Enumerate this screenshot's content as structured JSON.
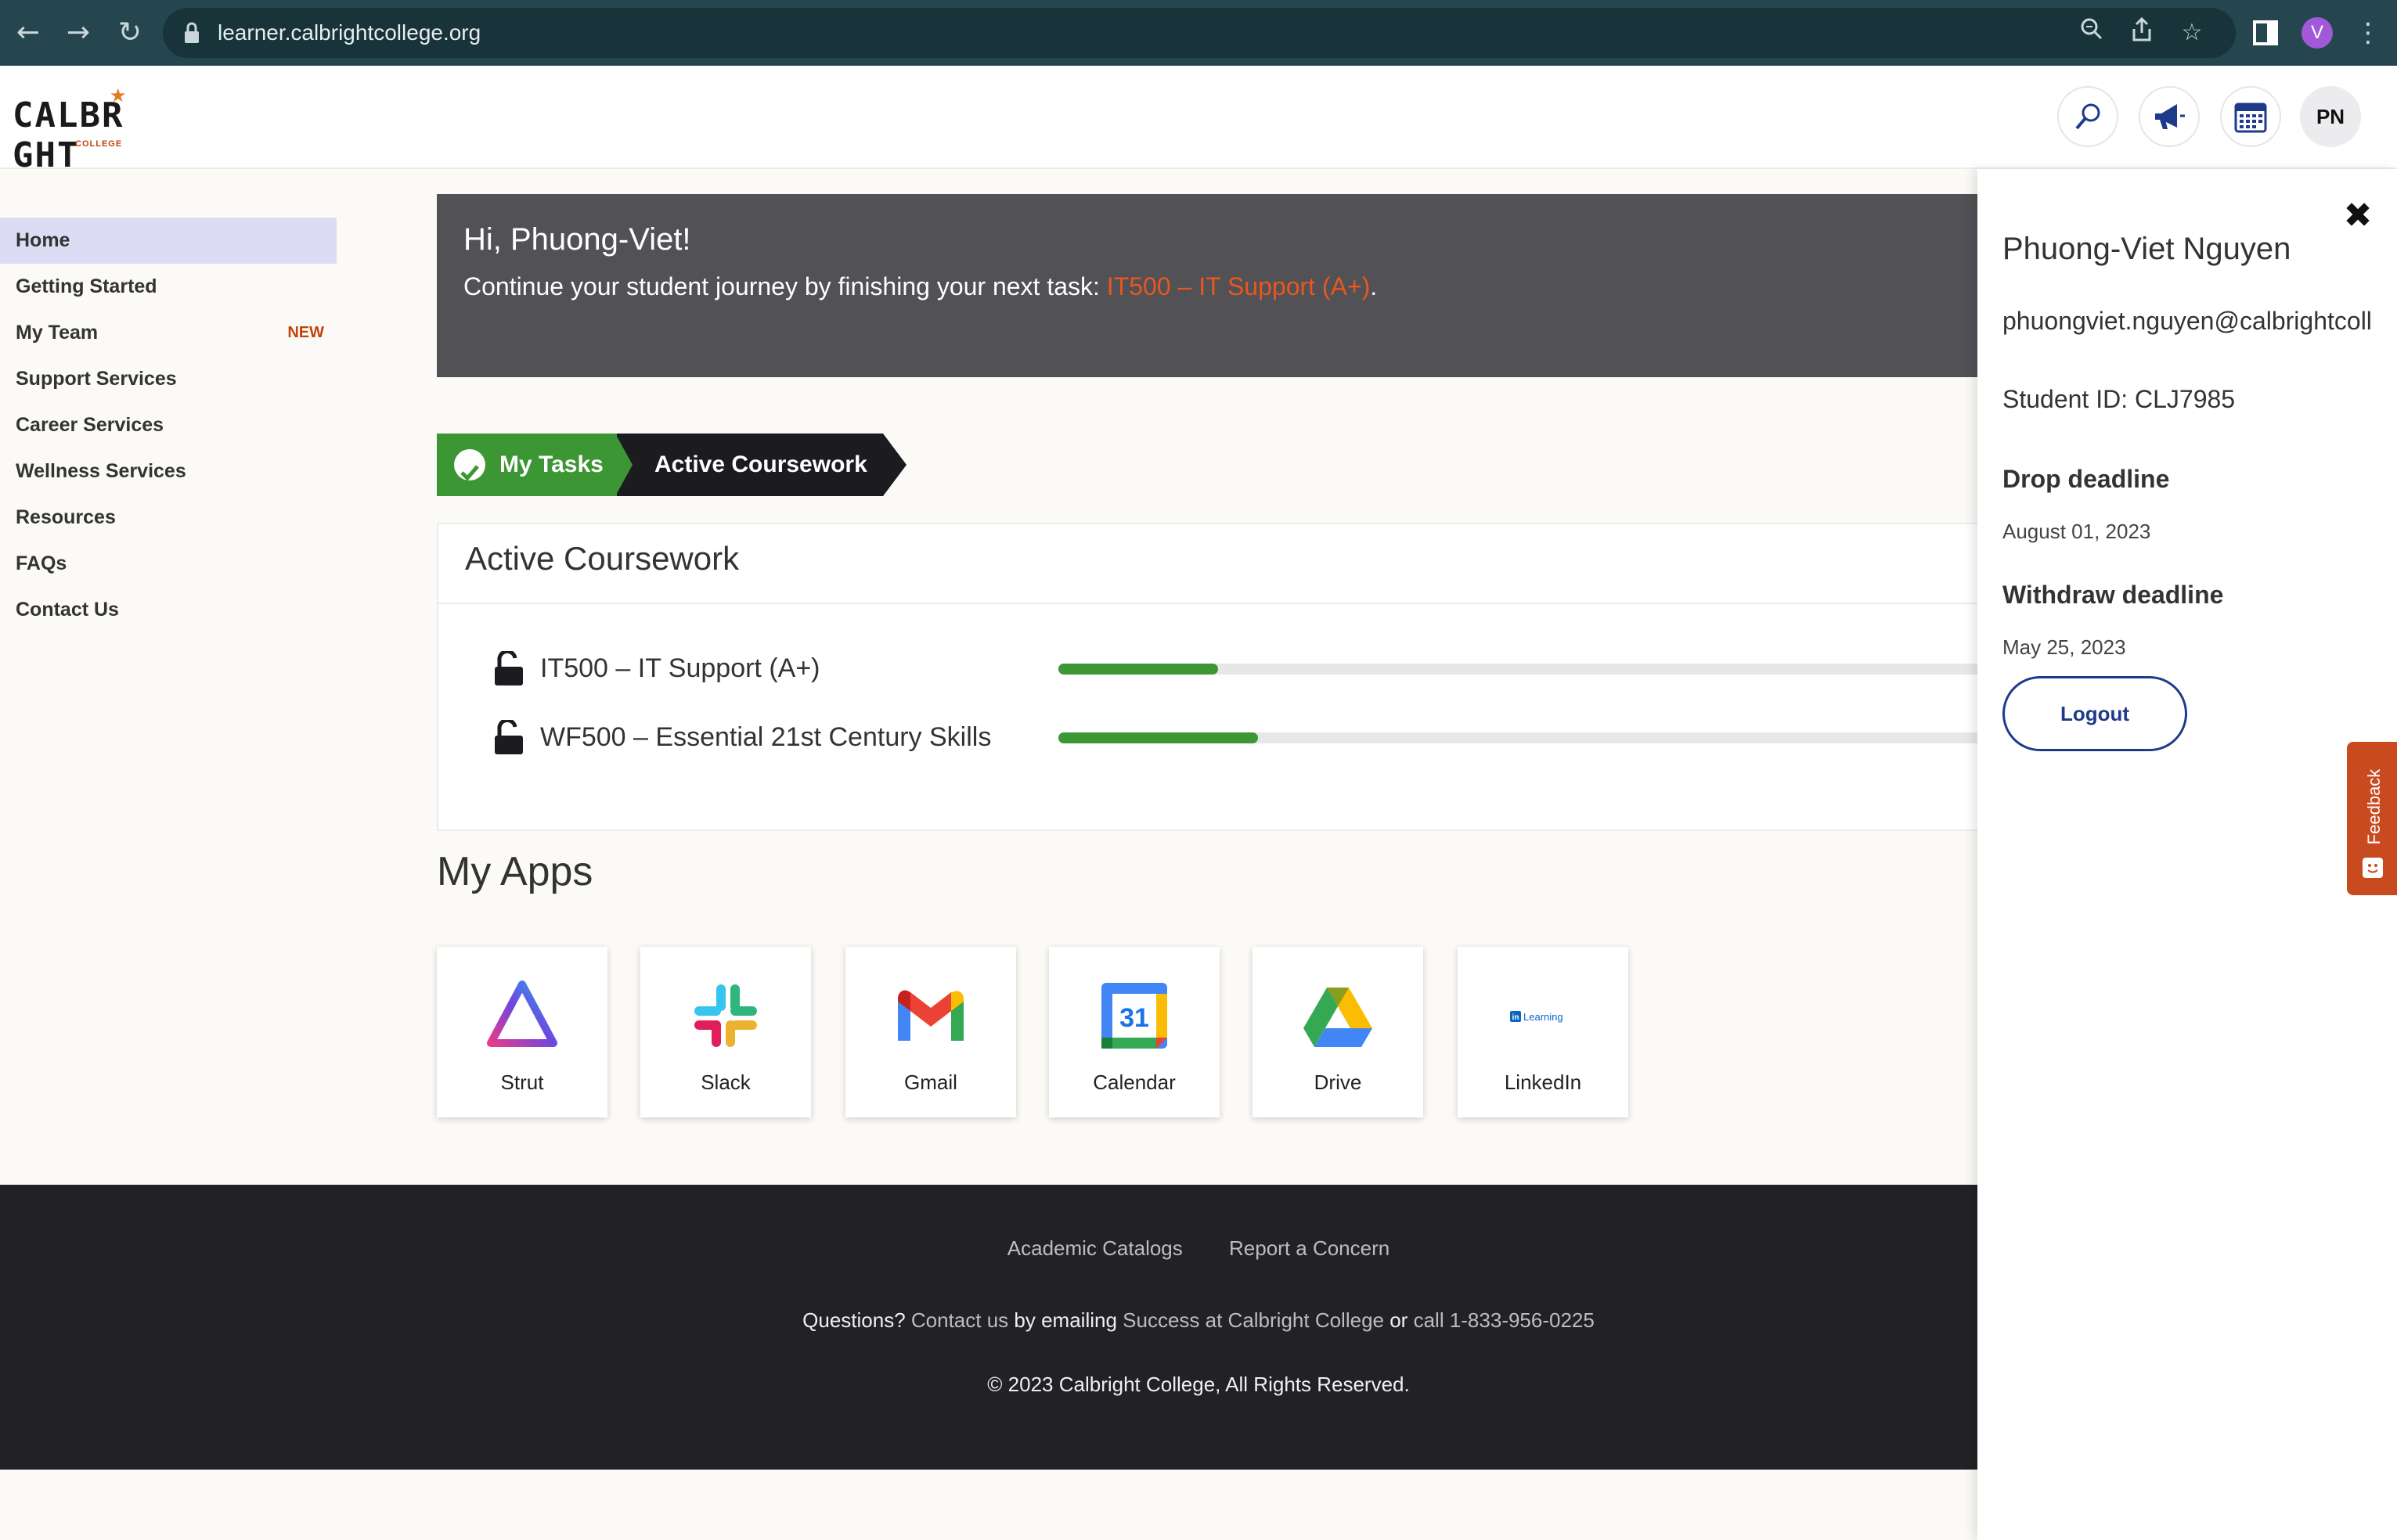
{
  "browser": {
    "url": "learner.calbrightcollege.org",
    "profile_initial": "V"
  },
  "header": {
    "logo_text": "CALBR GHT",
    "logo_sub": "COLLEGE",
    "avatar_initials": "PN"
  },
  "sidebar": {
    "items": [
      {
        "label": "Home",
        "badge": ""
      },
      {
        "label": "Getting Started",
        "badge": ""
      },
      {
        "label": "My Team",
        "badge": "NEW"
      },
      {
        "label": "Support Services",
        "badge": ""
      },
      {
        "label": "Career Services",
        "badge": ""
      },
      {
        "label": "Wellness Services",
        "badge": ""
      },
      {
        "label": "Resources",
        "badge": ""
      },
      {
        "label": "FAQs",
        "badge": ""
      },
      {
        "label": "Contact Us",
        "badge": ""
      }
    ]
  },
  "banner": {
    "greeting": "Hi, Phuong-Viet!",
    "text": "Continue your student journey by finishing your next task: ",
    "link": "IT500 – IT Support (A+)",
    "suffix": "."
  },
  "breadcrumb": {
    "step1": "My Tasks",
    "step2": "Active Coursework"
  },
  "coursework": {
    "title": "Active Coursework",
    "courses": [
      {
        "name": "IT500 – IT Support (A+)",
        "progress": 0.12
      },
      {
        "name": "WF500 – Essential 21st Century Skills",
        "progress": 0.15
      }
    ]
  },
  "apps": {
    "title": "My Apps",
    "items": [
      {
        "label": "Strut",
        "icon": "strut-logo-icon"
      },
      {
        "label": "Slack",
        "icon": "slack-logo-icon"
      },
      {
        "label": "Gmail",
        "icon": "gmail-logo-icon"
      },
      {
        "label": "Calendar",
        "icon": "calendar-logo-icon",
        "icon_text": "31"
      },
      {
        "label": "Drive",
        "icon": "drive-logo-icon"
      },
      {
        "label": "LinkedIn",
        "icon": "linkedin-learning-icon",
        "icon_text": "Learning"
      }
    ]
  },
  "footer": {
    "links": [
      "Academic Catalogs",
      "Report a Concern"
    ],
    "questions": {
      "prefix": "Questions? ",
      "contact": "Contact us",
      "mid": " by emailing ",
      "email": "Success at Calbright College",
      "or": " or ",
      "phone": "call 1-833-956-0225"
    },
    "copyright": "© 2023 Calbright College, All Rights Reserved."
  },
  "profile_panel": {
    "name": "Phuong-Viet Nguyen",
    "email": "phuongviet.nguyen@calbrightcoll",
    "student_id": "Student ID: CLJ7985",
    "drop_label": "Drop deadline",
    "drop_date": "August 01, 2023",
    "withdraw_label": "Withdraw deadline",
    "withdraw_date": "May 25, 2023",
    "logout_label": "Logout"
  },
  "feedback_tab": {
    "label": "Feedback"
  },
  "colors": {
    "accent_orange": "#e8571e",
    "progress_green": "#3d9634",
    "nav_active": "#dddcf5",
    "logout_blue": "#1e3a8a"
  }
}
